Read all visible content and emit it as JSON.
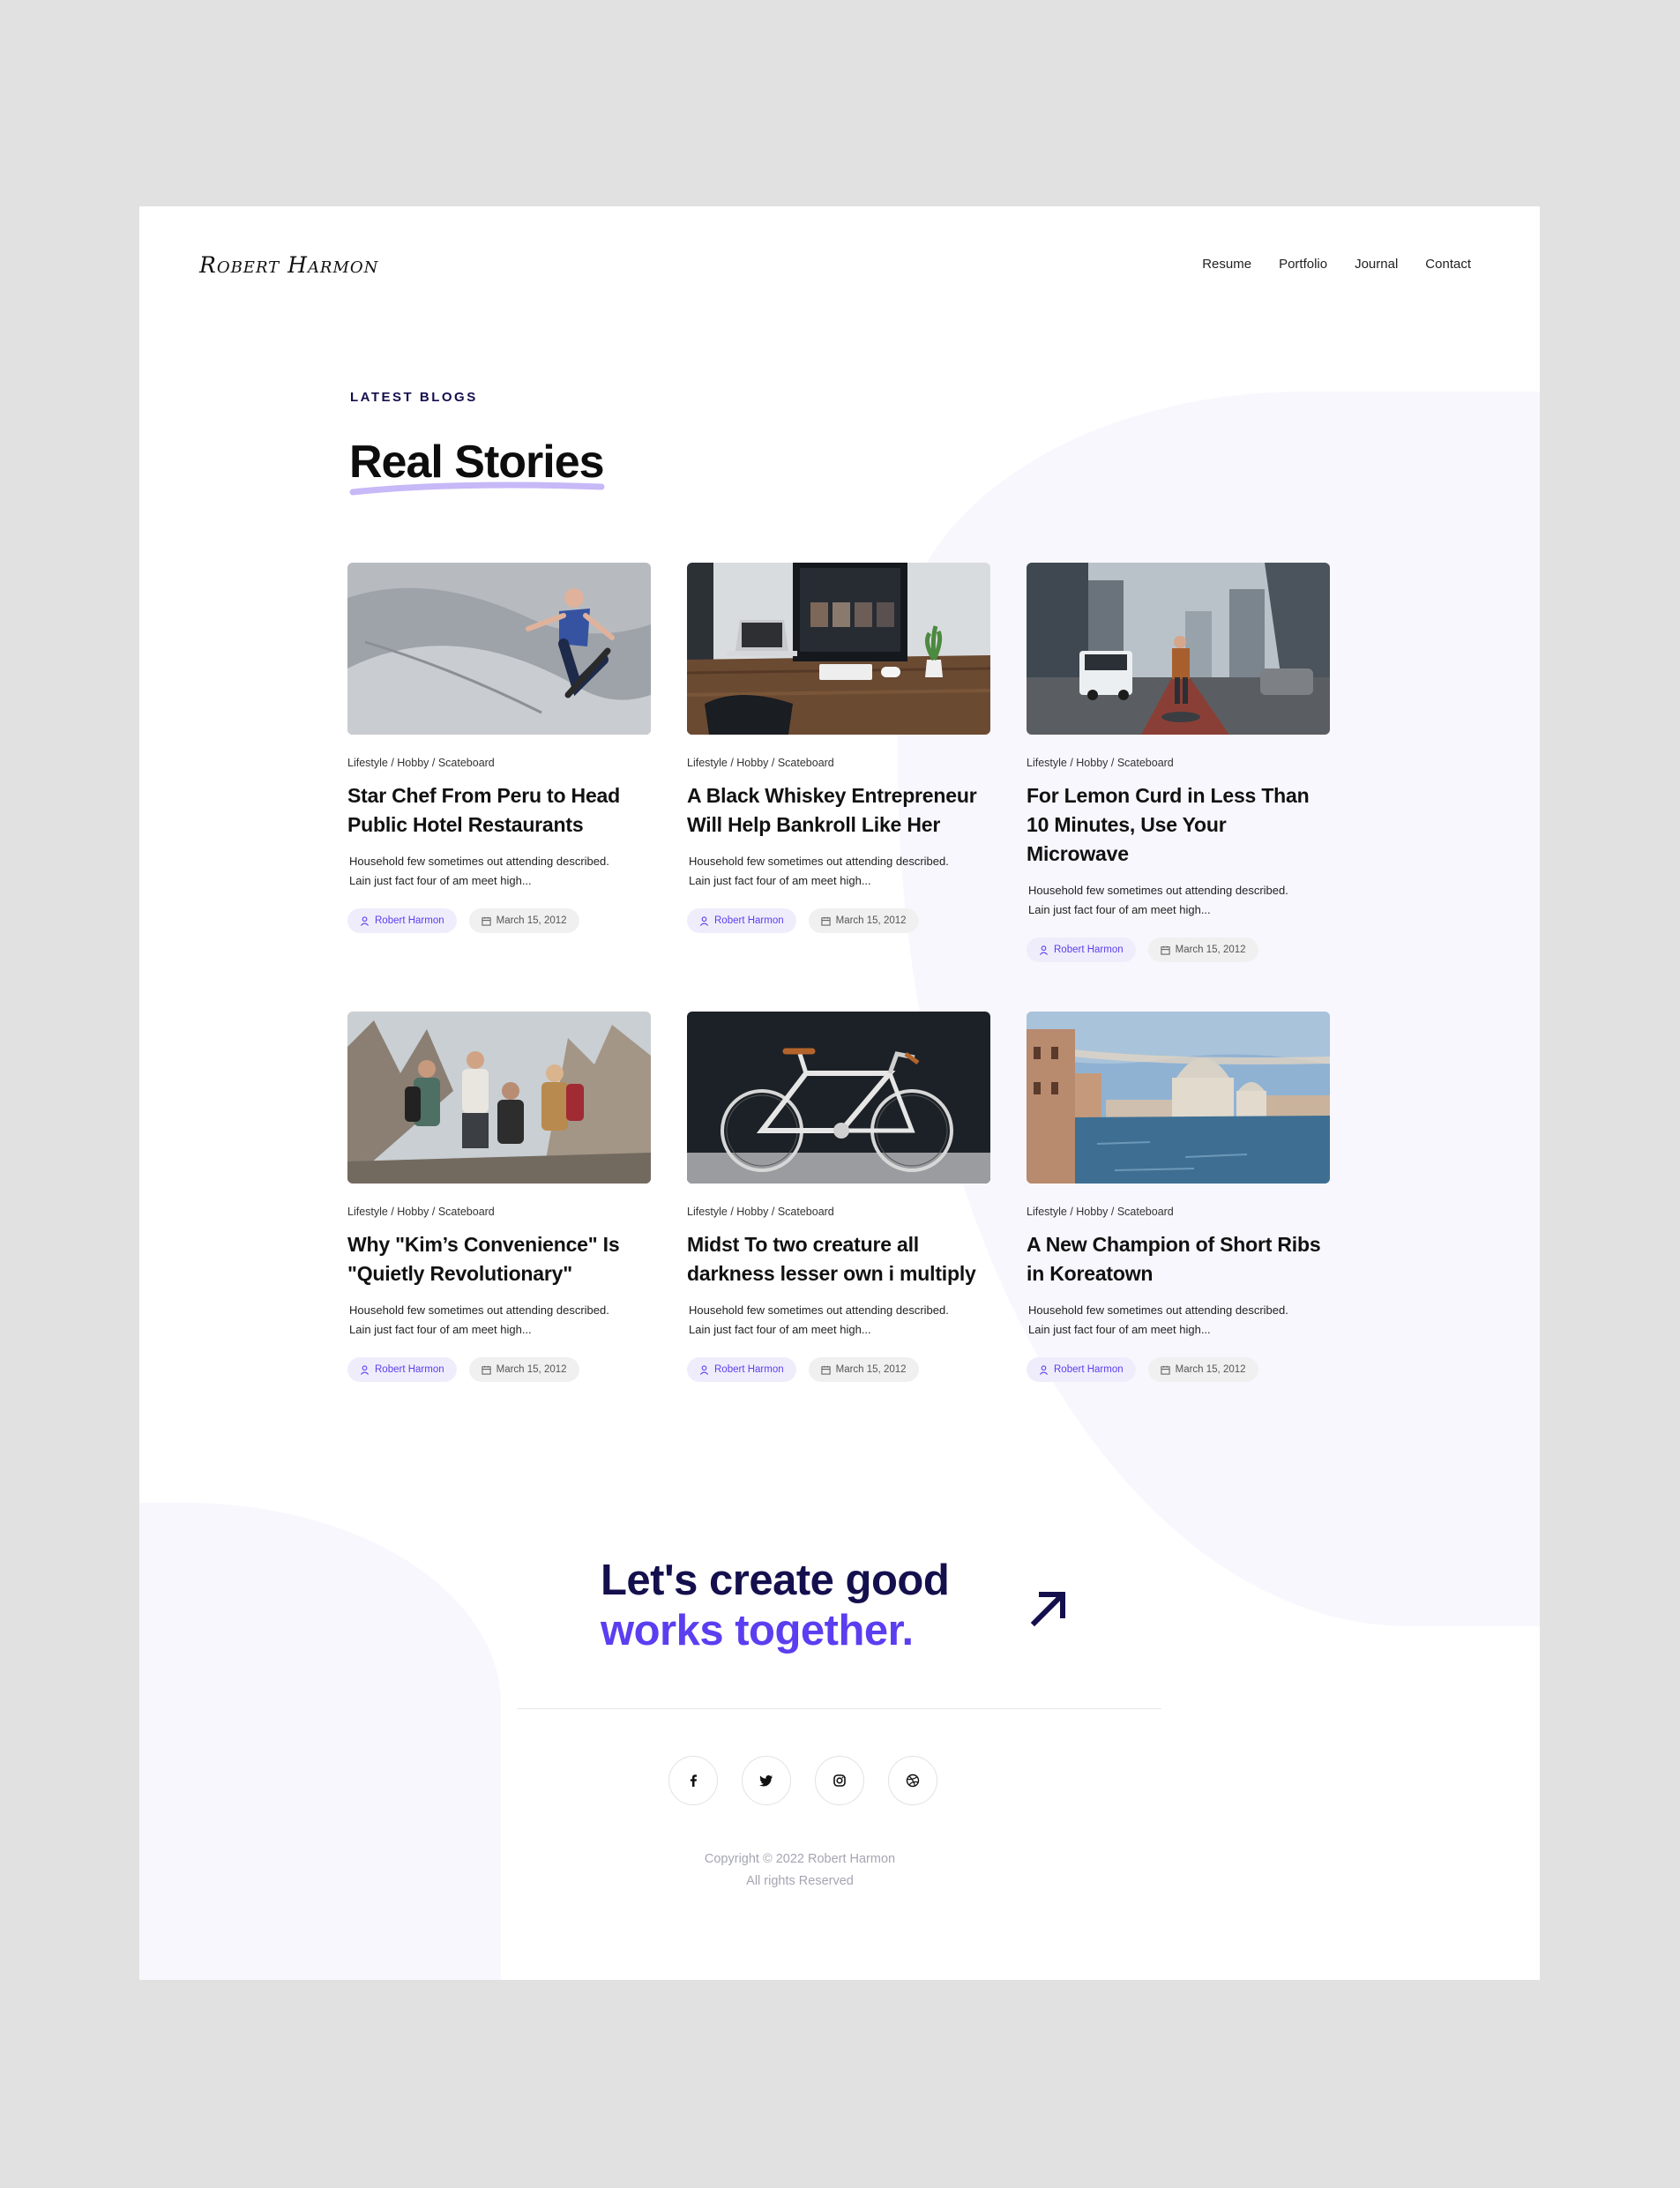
{
  "header": {
    "logo": "Robert Harmon",
    "nav": [
      "Resume",
      "Portfolio",
      "Journal",
      "Contact"
    ]
  },
  "section": {
    "eyebrow": "LATEST BLOGS",
    "title": "Real Stories"
  },
  "posts": [
    {
      "image": "skateboarder-in-bowl",
      "breadcrumb": "Lifestyle / Hobby / Scateboard",
      "title": "Star Chef From Peru to Head Public Hotel Restaurants",
      "excerpt_line1": "Household few sometimes out attending described.",
      "excerpt_line2": "Lain just fact four of am meet high...",
      "author": "Robert Harmon",
      "date": "March 15, 2012"
    },
    {
      "image": "desk-with-monitor-and-laptop",
      "breadcrumb": "Lifestyle / Hobby / Scateboard",
      "title": "A Black Whiskey Entrepreneur Will Help Bankroll Like Her",
      "excerpt_line1": "Household few sometimes out attending described.",
      "excerpt_line2": "Lain just fact four of am meet high...",
      "author": "Robert Harmon",
      "date": "March 15, 2012"
    },
    {
      "image": "city-street-traveler",
      "breadcrumb": "Lifestyle / Hobby / Scateboard",
      "title": "For Lemon Curd in Less Than 10 Minutes, Use Your Microwave",
      "excerpt_line1": "Household few sometimes out attending described.",
      "excerpt_line2": "Lain just fact four of am meet high...",
      "author": "Robert Harmon",
      "date": "March 15, 2012"
    },
    {
      "image": "friends-hiking-mountains",
      "breadcrumb": "Lifestyle / Hobby / Scateboard",
      "title": "Why \"Kim’s Convenience\" Is \"Quietly Revolutionary\"",
      "excerpt_line1": "Household few sometimes out attending described.",
      "excerpt_line2": "Lain just fact four of am meet high...",
      "author": "Robert Harmon",
      "date": "March 15, 2012"
    },
    {
      "image": "fixed-gear-bicycle",
      "breadcrumb": "Lifestyle / Hobby / Scateboard",
      "title": "Midst To two creature all darkness lesser own i multiply",
      "excerpt_line1": "Household few sometimes out attending described.",
      "excerpt_line2": "Lain just fact four of am meet high...",
      "author": "Robert Harmon",
      "date": "March 15, 2012"
    },
    {
      "image": "venice-grand-canal",
      "breadcrumb": "Lifestyle / Hobby / Scateboard",
      "title": "A New Champion of Short Ribs in Koreatown",
      "excerpt_line1": "Household few sometimes out attending described.",
      "excerpt_line2": "Lain just fact four of am meet high...",
      "author": "Robert Harmon",
      "date": "March 15, 2012"
    }
  ],
  "cta": {
    "line1": "Let's create good",
    "line2": "works together.",
    "icon": "arrow-up-right-icon"
  },
  "footer": {
    "socials": [
      "facebook-icon",
      "twitter-icon",
      "instagram-icon",
      "dribbble-icon"
    ],
    "copyright_line1": "Copyright © 2022 Robert Harmon",
    "copyright_line2": "All rights Reserved"
  },
  "colors": {
    "background": "#e1e1e1",
    "accent": "#5b3ef0",
    "navy": "#140f4d",
    "blob": "#f8f7fd"
  }
}
